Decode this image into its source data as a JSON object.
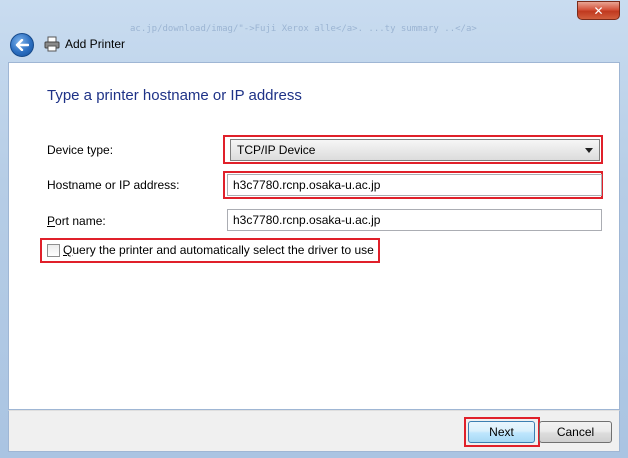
{
  "window": {
    "title": "Add Printer",
    "background_text": "ac.jp/download/imag/\"->Fuji Xerox alle</a>. ...ty summary ..</a>",
    "close_label": "✕"
  },
  "page": {
    "heading": "Type a printer hostname or IP address"
  },
  "form": {
    "device_type_label": "Device type:",
    "device_type_mnemonic": "t",
    "device_type_value": "TCP/IP Device",
    "hostname_label": "Hostname or IP address:",
    "hostname_value": "h3c7780.rcnp.osaka-u.ac.jp",
    "port_label_mnemonic": "P",
    "port_label_rest": "ort name:",
    "port_value": "h3c7780.rcnp.osaka-u.ac.jp",
    "query_mnemonic": "Q",
    "query_label_rest": "uery the printer and automatically select the driver to use",
    "query_checked": false
  },
  "buttons": {
    "next": "Next",
    "cancel": "Cancel"
  },
  "colors": {
    "heading": "#1e3287",
    "highlight_box": "#e0202a"
  },
  "icons": {
    "back": "back-arrow-icon",
    "printer": "printer-icon",
    "close": "close-icon",
    "dropdown": "chevron-down-icon"
  }
}
